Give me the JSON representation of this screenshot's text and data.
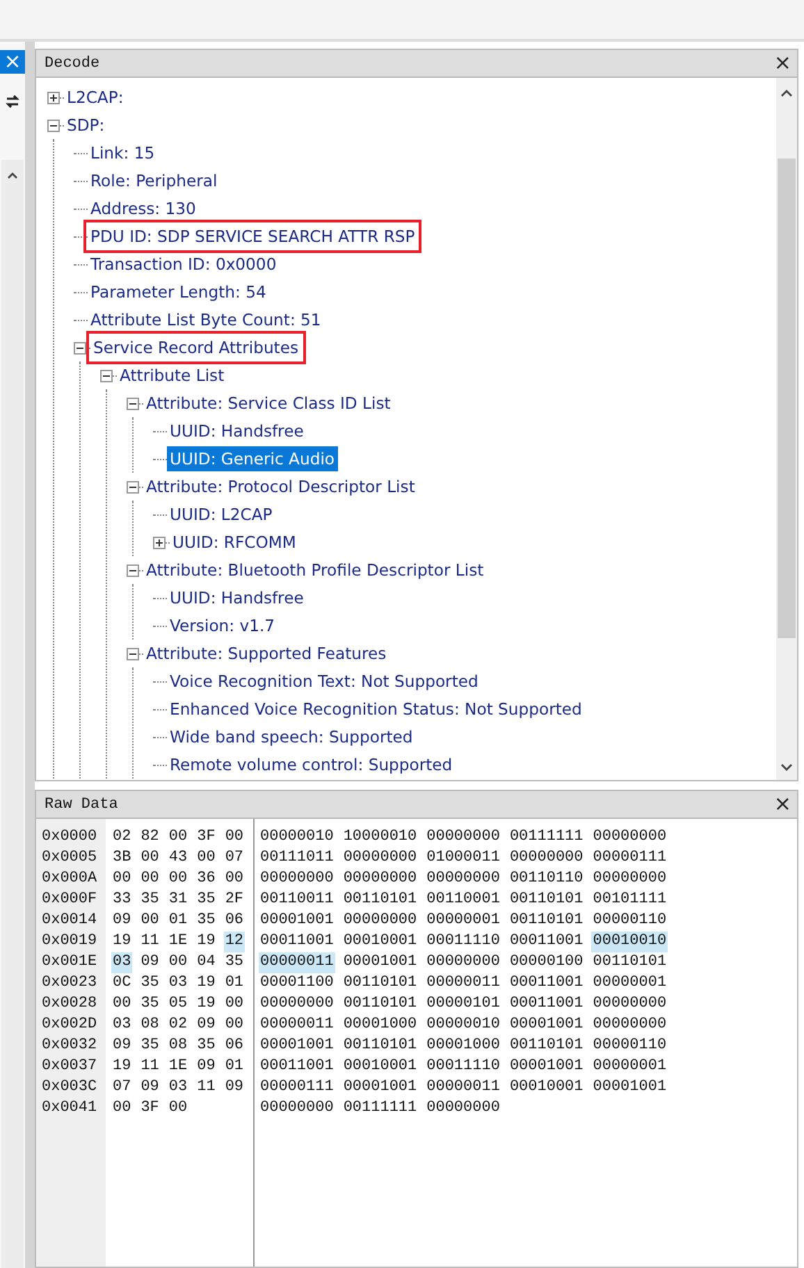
{
  "side_strip": {
    "close_symbol": "×"
  },
  "decode": {
    "title": "Decode",
    "close_symbol": "×",
    "tree": [
      {
        "label": "L2CAP:",
        "expanded": false,
        "selected": false,
        "outlined": false
      },
      {
        "label": "SDP:",
        "expanded": true,
        "selected": false,
        "outlined": false,
        "children": [
          {
            "label": "Link: 15",
            "selected": false,
            "outlined": false
          },
          {
            "label": "Role: Peripheral",
            "selected": false,
            "outlined": false
          },
          {
            "label": "Address: 130",
            "selected": false,
            "outlined": false
          },
          {
            "label": "PDU ID: SDP SERVICE SEARCH ATTR RSP",
            "selected": false,
            "outlined": true
          },
          {
            "label": "Transaction ID: 0x0000",
            "selected": false,
            "outlined": false
          },
          {
            "label": "Parameter Length: 54",
            "selected": false,
            "outlined": false
          },
          {
            "label": "Attribute List Byte Count: 51",
            "selected": false,
            "outlined": false
          },
          {
            "label": "Service Record Attributes",
            "expanded": true,
            "selected": false,
            "outlined": true,
            "children": [
              {
                "label": "Attribute List",
                "expanded": true,
                "selected": false,
                "outlined": false,
                "children": [
                  {
                    "label": "Attribute: Service Class ID List",
                    "expanded": true,
                    "selected": false,
                    "outlined": false,
                    "children": [
                      {
                        "label": "UUID: Handsfree",
                        "selected": false,
                        "outlined": false
                      },
                      {
                        "label": "UUID: Generic Audio",
                        "selected": true,
                        "outlined": false
                      }
                    ]
                  },
                  {
                    "label": "Attribute: Protocol Descriptor List",
                    "expanded": true,
                    "selected": false,
                    "outlined": false,
                    "children": [
                      {
                        "label": "UUID: L2CAP",
                        "selected": false,
                        "outlined": false
                      },
                      {
                        "label": "UUID: RFCOMM",
                        "expanded": false,
                        "selected": false,
                        "outlined": false
                      }
                    ]
                  },
                  {
                    "label": "Attribute: Bluetooth Profile Descriptor List",
                    "expanded": true,
                    "selected": false,
                    "outlined": false,
                    "children": [
                      {
                        "label": "UUID: Handsfree",
                        "selected": false,
                        "outlined": false
                      },
                      {
                        "label": "Version: v1.7",
                        "selected": false,
                        "outlined": false
                      }
                    ]
                  },
                  {
                    "label": "Attribute: Supported Features",
                    "expanded": true,
                    "selected": false,
                    "outlined": false,
                    "children": [
                      {
                        "label": "Voice Recognition Text: Not Supported",
                        "selected": false,
                        "outlined": false
                      },
                      {
                        "label": "Enhanced Voice Recognition Status: Not Supported",
                        "selected": false,
                        "outlined": false
                      },
                      {
                        "label": "Wide band speech: Supported",
                        "selected": false,
                        "outlined": false
                      },
                      {
                        "label": "Remote volume control: Supported",
                        "selected": false,
                        "outlined": false
                      }
                    ]
                  }
                ]
              }
            ]
          }
        ]
      }
    ]
  },
  "raw_data": {
    "title": "Raw Data",
    "close_symbol": "×",
    "rows": [
      {
        "offset": "0x0000",
        "bytes": [
          {
            "hex": "02",
            "bin": "00000010",
            "selected": false
          },
          {
            "hex": "82",
            "bin": "10000010",
            "selected": false
          },
          {
            "hex": "00",
            "bin": "00000000",
            "selected": false
          },
          {
            "hex": "3F",
            "bin": "00111111",
            "selected": false
          },
          {
            "hex": "00",
            "bin": "00000000",
            "selected": false
          }
        ]
      },
      {
        "offset": "0x0005",
        "bytes": [
          {
            "hex": "3B",
            "bin": "00111011",
            "selected": false
          },
          {
            "hex": "00",
            "bin": "00000000",
            "selected": false
          },
          {
            "hex": "43",
            "bin": "01000011",
            "selected": false
          },
          {
            "hex": "00",
            "bin": "00000000",
            "selected": false
          },
          {
            "hex": "07",
            "bin": "00000111",
            "selected": false
          }
        ]
      },
      {
        "offset": "0x000A",
        "bytes": [
          {
            "hex": "00",
            "bin": "00000000",
            "selected": false
          },
          {
            "hex": "00",
            "bin": "00000000",
            "selected": false
          },
          {
            "hex": "00",
            "bin": "00000000",
            "selected": false
          },
          {
            "hex": "36",
            "bin": "00110110",
            "selected": false
          },
          {
            "hex": "00",
            "bin": "00000000",
            "selected": false
          }
        ]
      },
      {
        "offset": "0x000F",
        "bytes": [
          {
            "hex": "33",
            "bin": "00110011",
            "selected": false
          },
          {
            "hex": "35",
            "bin": "00110101",
            "selected": false
          },
          {
            "hex": "31",
            "bin": "00110001",
            "selected": false
          },
          {
            "hex": "35",
            "bin": "00110101",
            "selected": false
          },
          {
            "hex": "2F",
            "bin": "00101111",
            "selected": false
          }
        ]
      },
      {
        "offset": "0x0014",
        "bytes": [
          {
            "hex": "09",
            "bin": "00001001",
            "selected": false
          },
          {
            "hex": "00",
            "bin": "00000000",
            "selected": false
          },
          {
            "hex": "01",
            "bin": "00000001",
            "selected": false
          },
          {
            "hex": "35",
            "bin": "00110101",
            "selected": false
          },
          {
            "hex": "06",
            "bin": "00000110",
            "selected": false
          }
        ]
      },
      {
        "offset": "0x0019",
        "bytes": [
          {
            "hex": "19",
            "bin": "00011001",
            "selected": false
          },
          {
            "hex": "11",
            "bin": "00010001",
            "selected": false
          },
          {
            "hex": "1E",
            "bin": "00011110",
            "selected": false
          },
          {
            "hex": "19",
            "bin": "00011001",
            "selected": false
          },
          {
            "hex": "12",
            "bin": "00010010",
            "selected": true
          }
        ]
      },
      {
        "offset": "0x001E",
        "bytes": [
          {
            "hex": "03",
            "bin": "00000011",
            "selected": true
          },
          {
            "hex": "09",
            "bin": "00001001",
            "selected": false
          },
          {
            "hex": "00",
            "bin": "00000000",
            "selected": false
          },
          {
            "hex": "04",
            "bin": "00000100",
            "selected": false
          },
          {
            "hex": "35",
            "bin": "00110101",
            "selected": false
          }
        ]
      },
      {
        "offset": "0x0023",
        "bytes": [
          {
            "hex": "0C",
            "bin": "00001100",
            "selected": false
          },
          {
            "hex": "35",
            "bin": "00110101",
            "selected": false
          },
          {
            "hex": "03",
            "bin": "00000011",
            "selected": false
          },
          {
            "hex": "19",
            "bin": "00011001",
            "selected": false
          },
          {
            "hex": "01",
            "bin": "00000001",
            "selected": false
          }
        ]
      },
      {
        "offset": "0x0028",
        "bytes": [
          {
            "hex": "00",
            "bin": "00000000",
            "selected": false
          },
          {
            "hex": "35",
            "bin": "00110101",
            "selected": false
          },
          {
            "hex": "05",
            "bin": "00000101",
            "selected": false
          },
          {
            "hex": "19",
            "bin": "00011001",
            "selected": false
          },
          {
            "hex": "00",
            "bin": "00000000",
            "selected": false
          }
        ]
      },
      {
        "offset": "0x002D",
        "bytes": [
          {
            "hex": "03",
            "bin": "00000011",
            "selected": false
          },
          {
            "hex": "08",
            "bin": "00001000",
            "selected": false
          },
          {
            "hex": "02",
            "bin": "00000010",
            "selected": false
          },
          {
            "hex": "09",
            "bin": "00001001",
            "selected": false
          },
          {
            "hex": "00",
            "bin": "00000000",
            "selected": false
          }
        ]
      },
      {
        "offset": "0x0032",
        "bytes": [
          {
            "hex": "09",
            "bin": "00001001",
            "selected": false
          },
          {
            "hex": "35",
            "bin": "00110101",
            "selected": false
          },
          {
            "hex": "08",
            "bin": "00001000",
            "selected": false
          },
          {
            "hex": "35",
            "bin": "00110101",
            "selected": false
          },
          {
            "hex": "06",
            "bin": "00000110",
            "selected": false
          }
        ]
      },
      {
        "offset": "0x0037",
        "bytes": [
          {
            "hex": "19",
            "bin": "00011001",
            "selected": false
          },
          {
            "hex": "11",
            "bin": "00010001",
            "selected": false
          },
          {
            "hex": "1E",
            "bin": "00011110",
            "selected": false
          },
          {
            "hex": "09",
            "bin": "00001001",
            "selected": false
          },
          {
            "hex": "01",
            "bin": "00000001",
            "selected": false
          }
        ]
      },
      {
        "offset": "0x003C",
        "bytes": [
          {
            "hex": "07",
            "bin": "00000111",
            "selected": false
          },
          {
            "hex": "09",
            "bin": "00001001",
            "selected": false
          },
          {
            "hex": "03",
            "bin": "00000011",
            "selected": false
          },
          {
            "hex": "11",
            "bin": "00010001",
            "selected": false
          },
          {
            "hex": "09",
            "bin": "00001001",
            "selected": false
          }
        ]
      },
      {
        "offset": "0x0041",
        "bytes": [
          {
            "hex": "00",
            "bin": "00000000",
            "selected": false
          },
          {
            "hex": "3F",
            "bin": "00111111",
            "selected": false
          },
          {
            "hex": "00",
            "bin": "00000000",
            "selected": false
          }
        ]
      }
    ]
  }
}
